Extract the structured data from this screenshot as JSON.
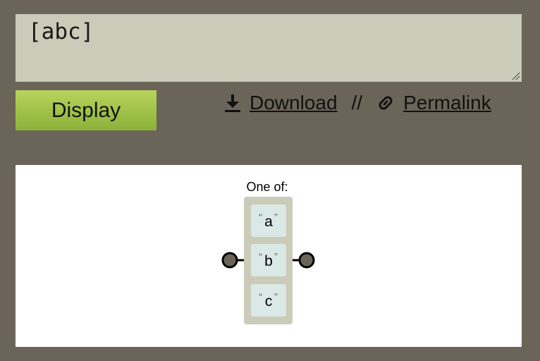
{
  "input": {
    "value": "[abc]"
  },
  "actions": {
    "display_label": "Display",
    "download_label": "Download",
    "separator": "//",
    "permalink_label": "Permalink"
  },
  "diagram": {
    "group_label": "One of:",
    "open_quote": "“",
    "close_quote": "”",
    "literals": [
      "a",
      "b",
      "c"
    ]
  }
}
